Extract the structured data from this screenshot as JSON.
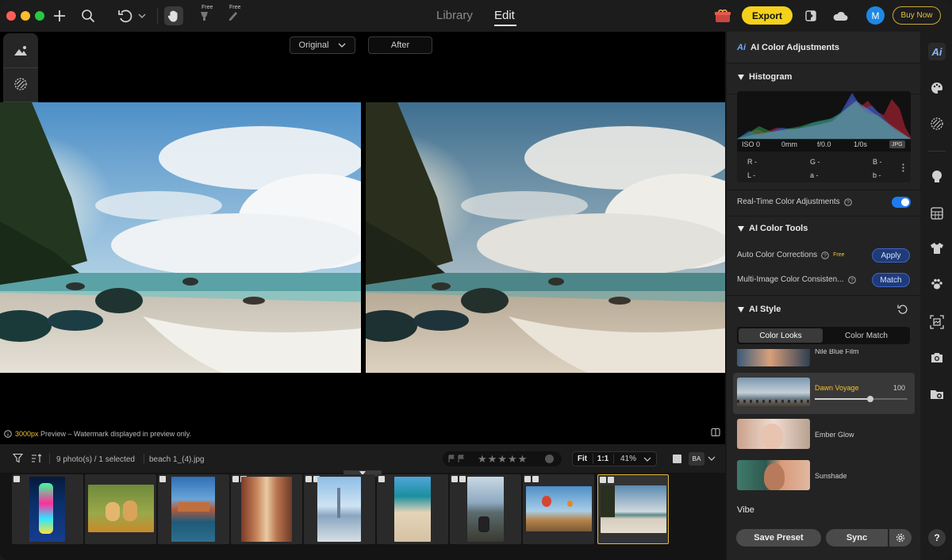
{
  "window": {
    "mode_tabs": [
      "Library",
      "Edit"
    ],
    "active_mode": "Edit"
  },
  "toolbar": {
    "free_tag_1": "Free",
    "free_tag_2": "Free",
    "export_label": "Export",
    "avatar_initial": "M",
    "buy_label": "Buy Now"
  },
  "compare": {
    "original_label": "Original",
    "after_label": "After"
  },
  "preview_note": {
    "size": "3000px",
    "text": " Preview – Watermark displayed in preview only."
  },
  "filmstrip": {
    "count_text": "9 photo(s) / 1 selected",
    "filename": "beach 1_(4).jpg",
    "fit_label": "Fit",
    "one_to_one": "1:1",
    "zoom": "41%",
    "ba_label": "BA",
    "thumbnails": [
      {
        "subject": "neon sign"
      },
      {
        "subject": "puppies on grass"
      },
      {
        "subject": "castle by water"
      },
      {
        "subject": "narrow street"
      },
      {
        "subject": "city skyline"
      },
      {
        "subject": "crowded beach"
      },
      {
        "subject": "hiker on cliff"
      },
      {
        "subject": "hot air balloons"
      },
      {
        "subject": "palm beach",
        "selected": true
      }
    ]
  },
  "panel": {
    "header": "AI Color Adjustments",
    "histogram": {
      "title": "Histogram",
      "iso": "ISO 0",
      "mm": "0mm",
      "fstop": "f/0.0",
      "shutter": "1/0s",
      "format": "JPG",
      "r": "R -",
      "g": "G -",
      "b": "B -",
      "l": "L -",
      "a": "a -",
      "b2": "b -"
    },
    "realtime": {
      "label": "Real-Time Color Adjustments",
      "enabled": true
    },
    "color_tools": {
      "title": "AI Color Tools",
      "auto_label": "Auto Color Corrections",
      "auto_free": "Free",
      "apply_label": "Apply",
      "multi_label": "Multi-Image Color Consisten...",
      "match_label": "Match"
    },
    "ai_style": {
      "title": "AI Style",
      "tabs": [
        "Color Looks",
        "Color Match"
      ],
      "active_tab": "Color Looks",
      "partial_look": "Nile Blue Film",
      "looks": [
        {
          "name": "Dawn Voyage",
          "value": "100",
          "selected": true,
          "strength": 0.6
        },
        {
          "name": "Ember Glow"
        },
        {
          "name": "Sunshade"
        }
      ],
      "vibe_label": "Vibe"
    },
    "save_preset_label": "Save Preset",
    "sync_label": "Sync",
    "help_label": "?"
  },
  "colors": {
    "accent_yellow": "#f4d11a",
    "toggle_blue": "#1e7cf0",
    "selected_gold": "#e2b93b"
  }
}
